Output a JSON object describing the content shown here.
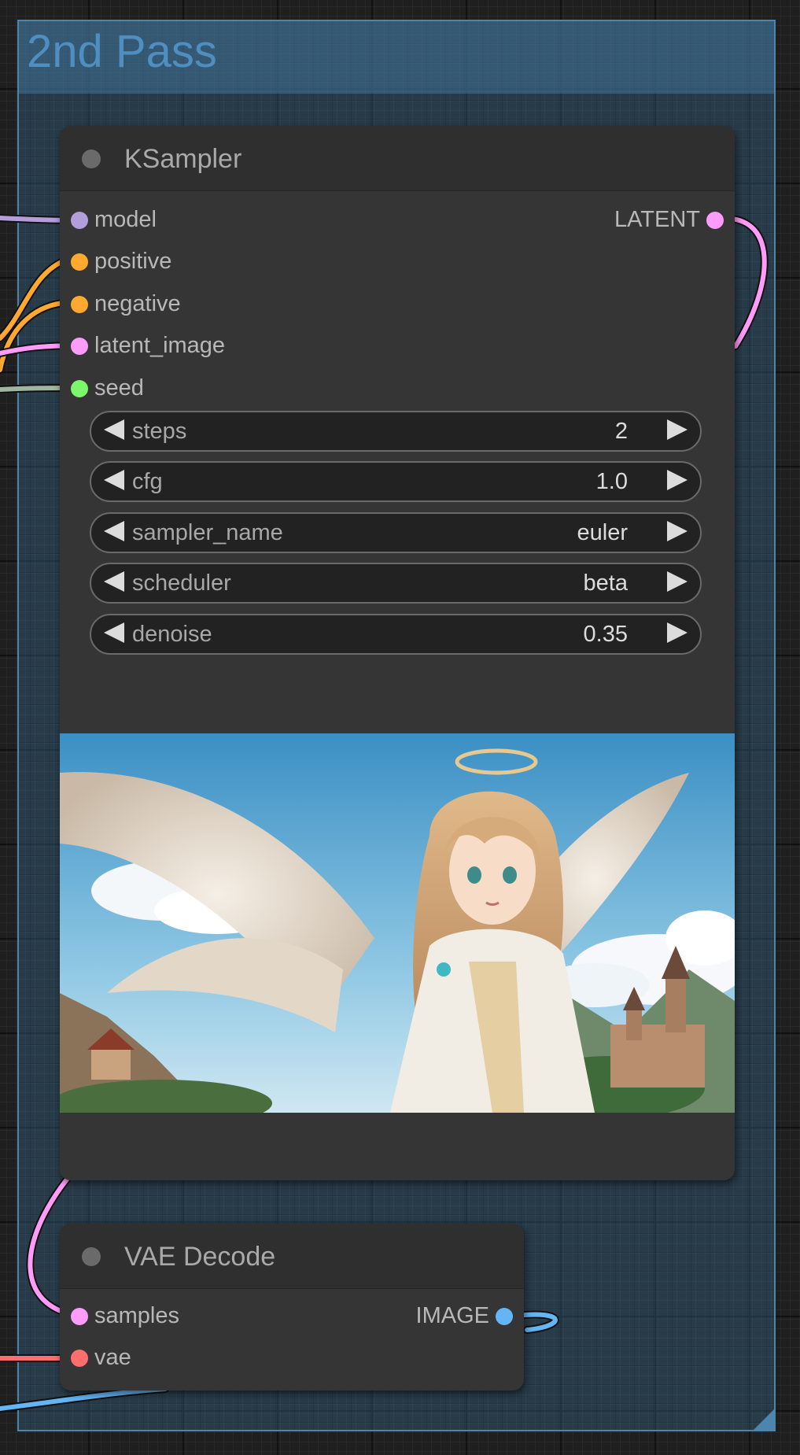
{
  "group": {
    "title": "2nd Pass"
  },
  "ksampler": {
    "title": "KSampler",
    "inputs": [
      {
        "label": "model",
        "color": "#b39ddb"
      },
      {
        "label": "positive",
        "color": "#ffa931"
      },
      {
        "label": "negative",
        "color": "#ffa931"
      },
      {
        "label": "latent_image",
        "color": "#ff9cf9"
      },
      {
        "label": "seed",
        "color": "#7cf76c"
      }
    ],
    "output": {
      "label": "LATENT",
      "color": "#ff9cf9"
    },
    "widgets": [
      {
        "label": "steps",
        "value": "2"
      },
      {
        "label": "cfg",
        "value": "1.0"
      },
      {
        "label": "sampler_name",
        "value": "euler"
      },
      {
        "label": "scheduler",
        "value": "beta"
      },
      {
        "label": "denoise",
        "value": "0.35"
      }
    ],
    "preview": {
      "description_icon": "image-preview"
    }
  },
  "vae_decode": {
    "title": "VAE Decode",
    "inputs": [
      {
        "label": "samples",
        "color": "#ff9cf9"
      },
      {
        "label": "vae",
        "color": "#ff6e6e"
      }
    ],
    "output": {
      "label": "IMAGE",
      "color": "#64b5f6"
    }
  },
  "colors": {
    "canvas_bg": "#1f1f1f",
    "group_border": "#4d85ad",
    "group_title": "#4f8ec0",
    "node_bg": "#353535",
    "widget_bg": "#222222"
  }
}
